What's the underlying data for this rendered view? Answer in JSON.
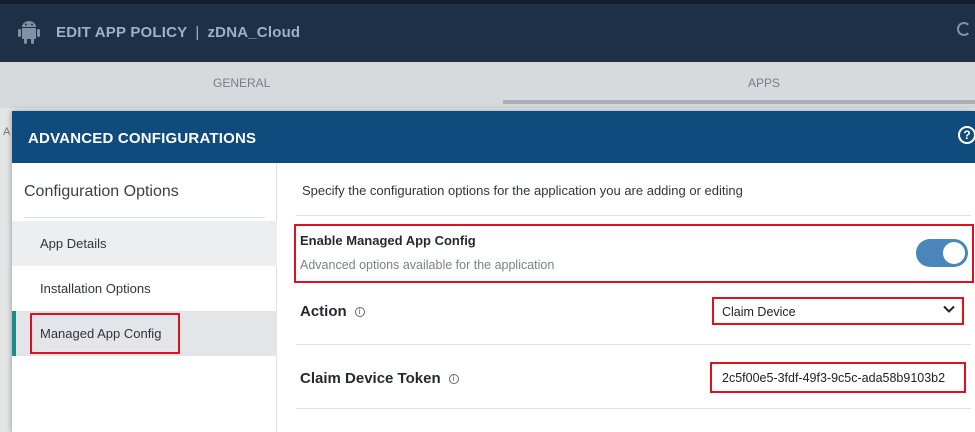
{
  "page": {
    "title": "EDIT APP POLICY",
    "separator": "|",
    "org": "zDNA_Cloud",
    "tabs": [
      {
        "label": "GENERAL"
      },
      {
        "label": "APPS"
      }
    ],
    "partial_left_text": "A"
  },
  "modal": {
    "title": "ADVANCED CONFIGURATIONS",
    "help_symbol": "?",
    "sidebar": {
      "heading": "Configuration Options",
      "items": [
        {
          "label": "App Details"
        },
        {
          "label": "Installation Options"
        },
        {
          "label": "Managed App Config"
        }
      ]
    },
    "content": {
      "intro": "Specify the configuration options for the application you are adding or editing",
      "managed": {
        "label": "Enable Managed App Config",
        "sublabel": "Advanced options available for the application",
        "enabled": true
      },
      "action": {
        "label": "Action",
        "info_symbol": "i",
        "selected": "Claim Device"
      },
      "token": {
        "label": "Claim Device Token",
        "info_symbol": "i",
        "value": "2c5f00e5-3fdf-49f3-9c5c-ada58b9103b2"
      }
    }
  },
  "colors": {
    "header_bg": "#104b7d",
    "topbar_bg": "#1e3048",
    "highlight_border": "#e0101c",
    "toggle_on": "#4a86b9",
    "nav_accent": "#1a8a8a"
  },
  "icons": [
    "android-icon",
    "help-icon",
    "info-icon",
    "chevron-down-icon"
  ]
}
